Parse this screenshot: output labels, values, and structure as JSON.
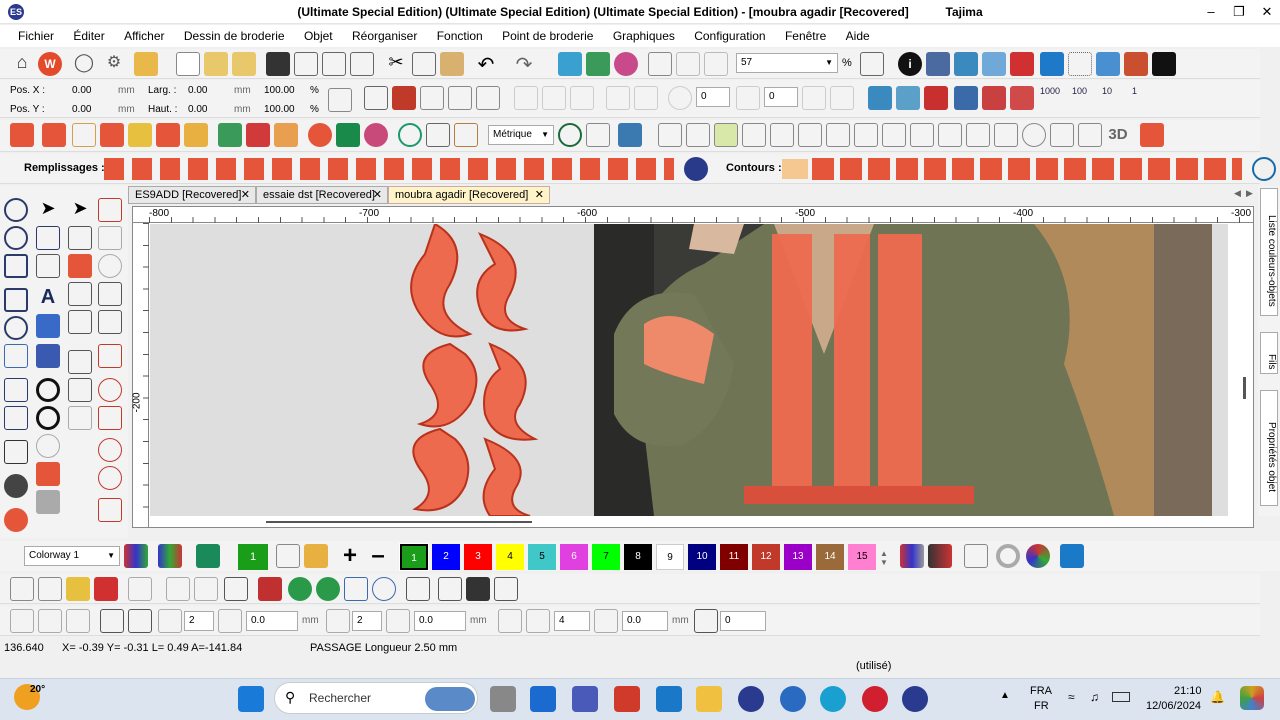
{
  "window": {
    "title": "(Ultimate Special Edition) (Ultimate Special Edition) (Ultimate Special Edition) - [moubra agadir [Recovered]",
    "vendor": "Tajima",
    "app_icon": "wilcom-icon",
    "controls": [
      "minimize-icon",
      "restore-icon",
      "close-icon"
    ]
  },
  "menu": {
    "items": [
      "Fichier",
      "Éditer",
      "Afficher",
      "Dessin de broderie",
      "Objet",
      "Réorganiser",
      "Fonction",
      "Point de broderie",
      "Graphiques",
      "Configuration",
      "Fenêtre",
      "Aide"
    ]
  },
  "toolbar1": {
    "zoom_value": "57",
    "zoom_unit": "%"
  },
  "position": {
    "pos_x_label": "Pos. X :",
    "pos_x_value": "0.00",
    "pos_x_unit": "mm",
    "pos_y_label": "Pos. Y :",
    "pos_y_value": "0.00",
    "pos_y_unit": "mm",
    "width_label": "Larg. :",
    "width_value": "0.00",
    "width_unit": "mm",
    "width_pct": "100.00",
    "height_label": "Haut. :",
    "height_value": "0.00",
    "height_unit": "mm",
    "height_pct": "100.00",
    "pct_symbol": "%",
    "rotate_value_1": "0",
    "rotate_value_2": "0"
  },
  "toolbar3": {
    "units_select": "Métrique",
    "label_3d": "3D"
  },
  "numbered_stitches": [
    "1000",
    "100",
    "10",
    "1"
  ],
  "fills_bar": {
    "fills_label": "Remplissages :",
    "contours_label": "Contours :"
  },
  "doc_tabs": [
    {
      "label": "ES9ADD [Recovered]",
      "active": false
    },
    {
      "label": "essaie dst [Recovered]",
      "active": false
    },
    {
      "label": "moubra agadir [Recovered]",
      "active": true
    }
  ],
  "ruler": {
    "top_ticks": [
      "-800",
      "-700",
      "-600",
      "-500",
      "-400",
      "-300"
    ],
    "left_ticks": [
      "-200"
    ]
  },
  "right_panel": {
    "tabs": [
      "Liste couleurs-objets",
      "Fils",
      "Propriétés objet"
    ]
  },
  "colorway": {
    "select": "Colorway 1",
    "current_color_number": "1",
    "swatches": [
      {
        "n": "1",
        "color": "#1a9e1a"
      },
      {
        "n": "2",
        "color": "#0000ff"
      },
      {
        "n": "3",
        "color": "#ff0000"
      },
      {
        "n": "4",
        "color": "#ffff00"
      },
      {
        "n": "5",
        "color": "#40c8c8"
      },
      {
        "n": "6",
        "color": "#e040e0"
      },
      {
        "n": "7",
        "color": "#00ff00"
      },
      {
        "n": "8",
        "color": "#000000"
      },
      {
        "n": "9",
        "color": "#ffffff"
      },
      {
        "n": "10",
        "color": "#000080"
      },
      {
        "n": "11",
        "color": "#800000"
      },
      {
        "n": "12",
        "color": "#c0392b"
      },
      {
        "n": "13",
        "color": "#9b00c8"
      },
      {
        "n": "14",
        "color": "#9a6a3a"
      },
      {
        "n": "15",
        "color": "#ff7fd0"
      }
    ]
  },
  "bottom_tools": {
    "value_2a": "2",
    "value_0a": "0.0",
    "unit_a": "mm",
    "value_2b": "2",
    "value_0b": "0.0",
    "unit_b": "mm",
    "value_4": "4",
    "value_0c": "0.0",
    "unit_c": "mm",
    "value_0d": "0"
  },
  "status": {
    "stitch_count": "136.640",
    "coords": "X=  -0.39 Y=   -0.31 L=   0.49 A=-141.84",
    "info": "PASSAGE Longueur   2.50 mm",
    "used": "(utilisé)"
  },
  "taskbar": {
    "weather_temp": "20°",
    "search_placeholder": "Rechercher",
    "lang_top": "FRA",
    "lang_bottom": "FR",
    "time": "21:10",
    "date": "12/06/2024"
  },
  "design_colors": {
    "embroidery": "#ee6a4f",
    "embroidery_dark": "#b8321c",
    "fabric": "#6e7454"
  }
}
